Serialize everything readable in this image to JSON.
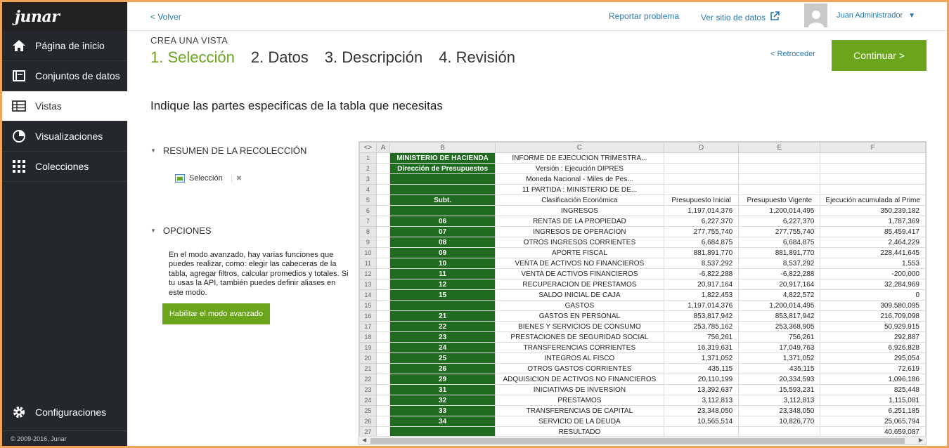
{
  "brand": {
    "logo": "junar",
    "accent": "#6aa51c"
  },
  "sidebar": {
    "items": [
      {
        "label": "Página de inicio",
        "icon": "home-icon"
      },
      {
        "label": "Conjuntos de datos",
        "icon": "folder-icon"
      },
      {
        "label": "Vistas",
        "icon": "table-icon",
        "active": true
      },
      {
        "label": "Visualizaciones",
        "icon": "pie-chart-icon"
      },
      {
        "label": "Colecciones",
        "icon": "grid-icon"
      }
    ],
    "settings": "Configuraciones",
    "copyright": "© 2009-2016, Junar"
  },
  "topbar": {
    "back": "< Volver",
    "report": "Reportar problema",
    "site": "Ver sitio de datos",
    "user": "Juan Administrador"
  },
  "wizard": {
    "kicker": "CREA UNA VISTA",
    "steps": [
      "1. Selección",
      "2. Datos",
      "3. Descripción",
      "4. Revisión"
    ],
    "back": "< Retroceder",
    "next": "Continuar >",
    "instruction": "Indique las partes especificas de la tabla que necesitas"
  },
  "panel": {
    "summary_title": "RESUMEN DE LA RECOLECCIÓN",
    "selection_label": "Selección",
    "options_title": "OPCIONES",
    "options_text": "En el modo avanzado, hay varias funciones que puedes realizar, como: elegir las cabeceras de la tabla, agregar filtros, calcular promedios y totales. Si tu usas la API, también puedes definir aliases en este modo.",
    "advanced_button": "Habilitar el modo avanzado"
  },
  "sheet": {
    "corner": "<>",
    "columns": [
      "A",
      "B",
      "C",
      "D",
      "E",
      "F"
    ],
    "rows": [
      [
        "",
        "MINISTERIO DE HACIENDA",
        "INFORME DE EJECUCION TRIMESTRA...",
        "",
        "",
        ""
      ],
      [
        "",
        "Dirección de Presupuestos",
        "Versión : Ejecución DIPRES",
        "",
        "",
        ""
      ],
      [
        "",
        "",
        "Moneda Nacional - Miles de Pes...",
        "",
        "",
        ""
      ],
      [
        "",
        "",
        "11 PARTIDA : MINISTERIO DE DE...",
        "",
        "",
        ""
      ],
      [
        "",
        "Subt.",
        "Clasificación Económica",
        "Presupuesto Inicial",
        "Presupuesto Vigente",
        "Ejecución acumulada al Prime"
      ],
      [
        "",
        "",
        "INGRESOS",
        "1,197,014,376",
        "1,200,014,495",
        "350,239,182"
      ],
      [
        "",
        "06",
        "RENTAS DE LA PROPIEDAD",
        "6,227,370",
        "6,227,370",
        "1,787,369"
      ],
      [
        "",
        "07",
        "INGRESOS DE OPERACION",
        "277,755,740",
        "277,755,740",
        "85,459,417"
      ],
      [
        "",
        "08",
        "OTROS INGRESOS CORRIENTES",
        "6,684,875",
        "6,684,875",
        "2,464,229"
      ],
      [
        "",
        "09",
        "APORTE FISCAL",
        "881,891,770",
        "881,891,770",
        "228,441,645"
      ],
      [
        "",
        "10",
        "VENTA DE ACTIVOS NO FINANCIEROS",
        "8,537,292",
        "8,537,292",
        "1,553"
      ],
      [
        "",
        "11",
        "VENTA DE ACTIVOS FINANCIEROS",
        "-6,822,288",
        "-6,822,288",
        "-200,000"
      ],
      [
        "",
        "12",
        "RECUPERACION DE PRESTAMOS",
        "20,917,164",
        "20,917,164",
        "32,284,969"
      ],
      [
        "",
        "15",
        "SALDO INICIAL DE CAJA",
        "1,822,453",
        "4,822,572",
        "0"
      ],
      [
        "",
        "",
        "GASTOS",
        "1,197,014,376",
        "1,200,014,495",
        "309,580,095"
      ],
      [
        "",
        "21",
        "GASTOS EN PERSONAL",
        "853,817,942",
        "853,817,942",
        "216,709,098"
      ],
      [
        "",
        "22",
        "BIENES Y SERVICIOS DE CONSUMO",
        "253,785,162",
        "253,368,905",
        "50,929,915"
      ],
      [
        "",
        "23",
        "PRESTACIONES DE SEGURIDAD SOCIAL",
        "756,261",
        "756,261",
        "292,887"
      ],
      [
        "",
        "24",
        "TRANSFERENCIAS CORRIENTES",
        "16,319,631",
        "17,049,763",
        "6,926,828"
      ],
      [
        "",
        "25",
        "INTEGROS AL FISCO",
        "1,371,052",
        "1,371,052",
        "295,054"
      ],
      [
        "",
        "26",
        "OTROS GASTOS CORRIENTES",
        "435,115",
        "435,115",
        "72,619"
      ],
      [
        "",
        "29",
        "ADQUISICION DE ACTIVOS NO FINANCIEROS",
        "20,110,199",
        "20,334,593",
        "1,096,186"
      ],
      [
        "",
        "31",
        "INICIATIVAS DE INVERSION",
        "13,392,637",
        "15,593,231",
        "825,448"
      ],
      [
        "",
        "32",
        "PRESTAMOS",
        "3,112,813",
        "3,112,813",
        "1,115,081"
      ],
      [
        "",
        "33",
        "TRANSFERENCIAS DE CAPITAL",
        "23,348,050",
        "23,348,050",
        "6,251,185"
      ],
      [
        "",
        "34",
        "SERVICIO DE LA DEUDA",
        "10,565,514",
        "10,826,770",
        "25,065,794"
      ],
      [
        "",
        "",
        "RESULTADO",
        "",
        "",
        "40,659,087"
      ]
    ]
  }
}
